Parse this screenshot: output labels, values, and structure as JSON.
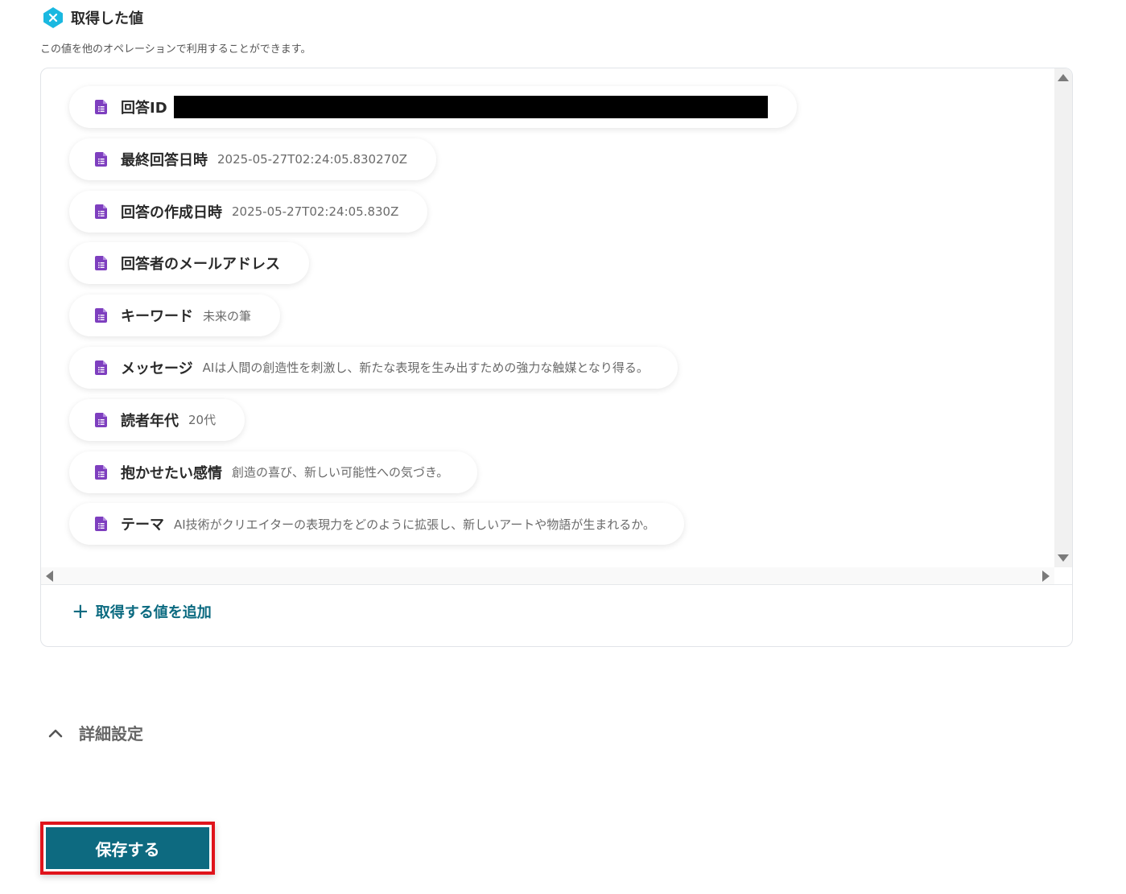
{
  "section": {
    "title": "取得した値",
    "description": "この値を他のオペレーションで利用することができます。"
  },
  "values": [
    {
      "label": "回答ID",
      "value": "",
      "redacted": true
    },
    {
      "label": "最終回答日時",
      "value": "2025-05-27T02:24:05.830270Z"
    },
    {
      "label": "回答の作成日時",
      "value": "2025-05-27T02:24:05.830Z"
    },
    {
      "label": "回答者のメールアドレス",
      "value": ""
    },
    {
      "label": "キーワード",
      "value": "未来の筆"
    },
    {
      "label": "メッセージ",
      "value": "AIは人間の創造性を刺激し、新たな表現を生み出すための強力な触媒となり得る。"
    },
    {
      "label": "読者年代",
      "value": "20代"
    },
    {
      "label": "抱かせたい感情",
      "value": "創造の喜び、新しい可能性への気づき。"
    },
    {
      "label": "テーマ",
      "value": "AI技術がクリエイターの表現力をどのように拡張し、新しいアートや物語が生まれるか。"
    }
  ],
  "add_value": {
    "icon": "+",
    "label": "取得する値を追加"
  },
  "advanced": {
    "label": "詳細設定"
  },
  "save": {
    "label": "保存する"
  },
  "colors": {
    "accent": "#0d6a80",
    "doc_icon": "#7e3fbf",
    "header_icon": "#1ab8e0",
    "highlight_border": "#e0141c"
  }
}
